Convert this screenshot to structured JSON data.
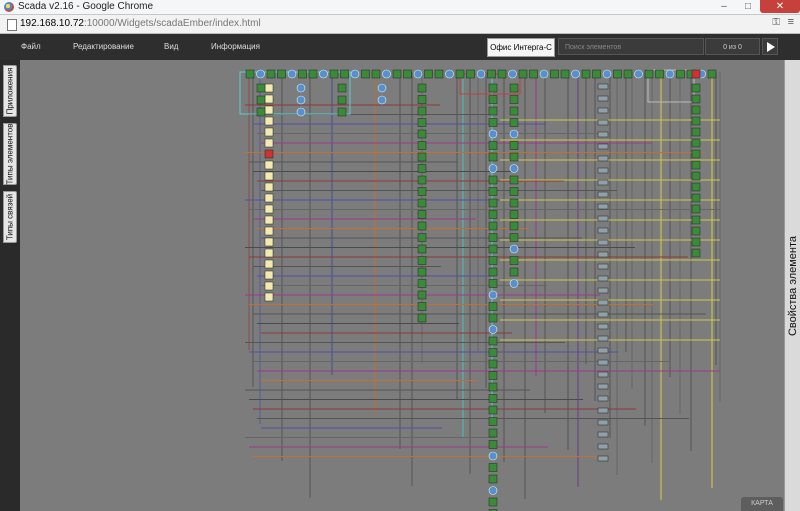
{
  "window": {
    "title": "Scada v2.16 - Google Chrome"
  },
  "address": {
    "host": "192.168.10.72",
    "rest": ":10000/Widgets/scadaEmber/index.html",
    "key_icon": "key-icon",
    "menu_icon": "menu-icon"
  },
  "menu": {
    "items": [
      "Файл",
      "Редактирование",
      "Вид",
      "Информация"
    ]
  },
  "toolbar": {
    "office_label": "Офис Интерга-С",
    "search_placeholder": "Поиск элементов",
    "counter": "0 из 0",
    "play_icon": "play-icon"
  },
  "left_tabs": [
    "Приложения",
    "Типы элементов",
    "Типы связей"
  ],
  "right_panel": {
    "label": "Свойства элемента"
  },
  "map_button": {
    "label": "КАРТА"
  },
  "colors": {
    "node_green": "#3a8a3a",
    "node_yellow": "#f2eab0",
    "node_blue": "#5a8ed0",
    "node_red": "#cc3333",
    "appbar": "#2e2e2e",
    "canvas": "#7c7c7c"
  }
}
